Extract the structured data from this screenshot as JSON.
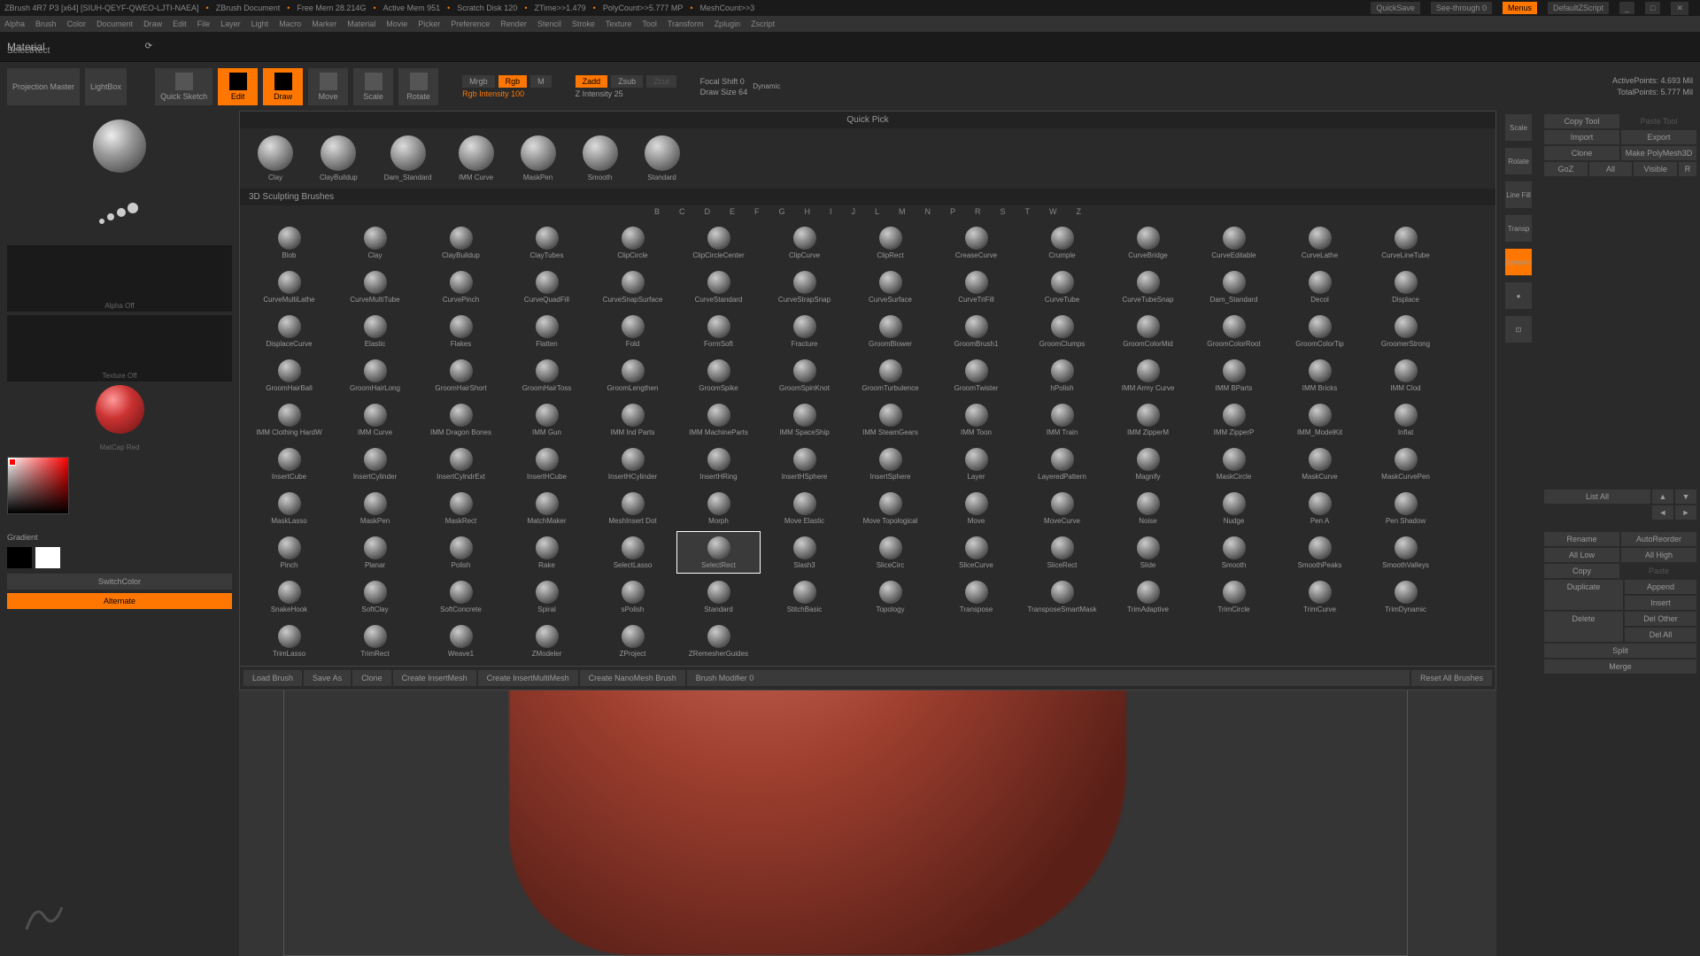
{
  "titlebar": {
    "app": "ZBrush 4R7 P3 [x64] [SIUH-QEYF-QWEO-LJTI-NAEA]",
    "doc": "ZBrush Document",
    "mem": "Free Mem 28.214G",
    "activemem": "Active Mem 951",
    "scratch": "Scratch Disk 120",
    "ztime": "ZTime>>1.479",
    "poly": "PolyCount>>5.777 MP",
    "mesh": "MeshCount>>3",
    "quicksave": "QuickSave",
    "seethrough": "See-through  0",
    "menus": "Menus",
    "script": "DefaultZScript"
  },
  "menus": [
    "Alpha",
    "Brush",
    "Color",
    "Document",
    "Draw",
    "Edit",
    "File",
    "Layer",
    "Light",
    "Macro",
    "Marker",
    "Material",
    "Movie",
    "Picker",
    "Preference",
    "Render",
    "Stencil",
    "Stroke",
    "Texture",
    "Tool",
    "Transform",
    "Zplugin",
    "Zscript"
  ],
  "material_label": "Material",
  "selectrect": "SelectRect",
  "toolbar": {
    "projection": "Projection\nMaster",
    "lightbox": "LightBox",
    "quicksketch": "Quick\nSketch",
    "edit": "Edit",
    "draw": "Draw",
    "move": "Move",
    "scale": "Scale",
    "rotate": "Rotate",
    "mrgb": "Mrgb",
    "rgb": "Rgb",
    "m": "M",
    "rgbint": "Rgb Intensity 100",
    "zadd": "Zadd",
    "zsub": "Zsub",
    "zcut": "Zcut",
    "zint": "Z Intensity 25",
    "focal": "Focal Shift 0",
    "drawsize": "Draw Size 64",
    "dynamic": "Dynamic",
    "activepoints": "ActivePoints: 4.693 Mil",
    "totalpoints": "TotalPoints: 5.777 Mil"
  },
  "quickpick_label": "Quick Pick",
  "quickpick": [
    "Clay",
    "ClayBuildup",
    "Dam_Standard",
    "IMM Curve",
    "MaskPen",
    "Smooth",
    "Standard"
  ],
  "section_3d": "3D Sculpting Brushes",
  "letters": [
    "B",
    "C",
    "D",
    "E",
    "F",
    "G",
    "H",
    "I",
    "J",
    "L",
    "M",
    "N",
    "P",
    "R",
    "S",
    "T",
    "W",
    "Z"
  ],
  "brushes": [
    "Blob",
    "Clay",
    "ClayBuildup",
    "ClayTubes",
    "ClipCircle",
    "ClipCircleCenter",
    "ClipCurve",
    "ClipRect",
    "CreaseCurve",
    "Crumple",
    "CurveBridge",
    "CurveEditable",
    "CurveLathe",
    "CurveLineTube",
    "CurveMultiLathe",
    "CurveMultiTube",
    "CurvePinch",
    "CurveQuadFill",
    "CurveSnapSurface",
    "CurveStandard",
    "CurveStrapSnap",
    "CurveSurface",
    "CurveTriFill",
    "CurveTube",
    "CurveTubeSnap",
    "Dam_Standard",
    "Decol",
    "Displace",
    "DisplaceCurve",
    "Elastic",
    "Flakes",
    "Flatten",
    "Fold",
    "FormSoft",
    "Fracture",
    "GroomBlower",
    "GroomBrush1",
    "GroomClumps",
    "GroomColorMid",
    "GroomColorRoot",
    "GroomColorTip",
    "GroomerStrong",
    "GroomHairBall",
    "GroomHairLong",
    "GroomHairShort",
    "GroomHairToss",
    "GroomLengthen",
    "GroomSpike",
    "GroomSpinKnot",
    "GroomTurbulence",
    "GroomTwister",
    "hPolish",
    "IMM Army Curve",
    "IMM BParts",
    "IMM Bricks",
    "IMM Clod",
    "IMM Clothing HardW",
    "IMM Curve",
    "IMM Dragon Bones",
    "IMM Gun",
    "IMM Ind Parts",
    "IMM MachineParts",
    "IMM SpaceShip",
    "IMM SteamGears",
    "IMM Toon",
    "IMM Train",
    "IMM ZipperM",
    "IMM ZipperP",
    "IMM_ModelKit",
    "Inflat",
    "InsertCube",
    "InsertCylinder",
    "InsertCylndrExt",
    "InsertHCube",
    "InsertHCylinder",
    "InsertHRing",
    "InsertHSphere",
    "InsertSphere",
    "Layer",
    "LayeredPattern",
    "Magnify",
    "MaskCircle",
    "MaskCurve",
    "MaskCurvePen",
    "MaskLasso",
    "MaskPen",
    "MaskRect",
    "MatchMaker",
    "MeshInsert Dot",
    "Morph",
    "Move Elastic",
    "Move Topological",
    "Move",
    "MoveCurve",
    "Noise",
    "Nudge",
    "Pen A",
    "Pen Shadow",
    "Pinch",
    "Planar",
    "Polish",
    "Rake",
    "SelectLasso",
    "SelectRect",
    "Slash3",
    "SliceCirc",
    "SliceCurve",
    "SliceRect",
    "Slide",
    "Smooth",
    "SmoothPeaks",
    "SmoothValleys",
    "SnakeHook",
    "SoftClay",
    "SoftConcrete",
    "Spiral",
    "sPolish",
    "Standard",
    "StitchBasic",
    "Topology",
    "Transpose",
    "TransposeSmartMask",
    "TrimAdaptive",
    "TrimCircle",
    "TrimCurve",
    "TrimDynamic",
    "TrimLasso",
    "TrimRect",
    "Weave1",
    "ZModeler",
    "ZProject",
    "ZRemesherGuides"
  ],
  "selected_brush": "SelectRect",
  "bottom": {
    "load": "Load Brush",
    "save": "Save As",
    "clone": "Clone",
    "cim": "Create InsertMesh",
    "cimm": "Create InsertMultiMesh",
    "cnm": "Create NanoMesh Brush",
    "mod": "Brush Modifier 0",
    "reset": "Reset All Brushes"
  },
  "left": {
    "gradient": "Gradient",
    "switch": "SwitchColor",
    "alternate": "Alternate"
  },
  "right": {
    "copytool": "Copy Tool",
    "pastetool": "Paste Tool",
    "import": "Import",
    "export": "Export",
    "clone": "Clone",
    "makepoly": "Make PolyMesh3D",
    "goz": "GoZ",
    "all": "All",
    "visible": "Visible",
    "r": "R",
    "rename": "Rename",
    "autoreorder": "AutoReorder",
    "alllow": "All Low",
    "allhigh": "All High",
    "copy": "Copy",
    "paste": "Paste",
    "duplicate": "Duplicate",
    "append": "Append",
    "insert": "Insert",
    "delete": "Delete",
    "delother": "Del Other",
    "delall": "Del All",
    "split": "Split",
    "merge": "Merge",
    "listall": "List All"
  },
  "righttools": [
    "Scale",
    "Rotate",
    "Line Fill",
    "Transp",
    "Dynamic"
  ]
}
